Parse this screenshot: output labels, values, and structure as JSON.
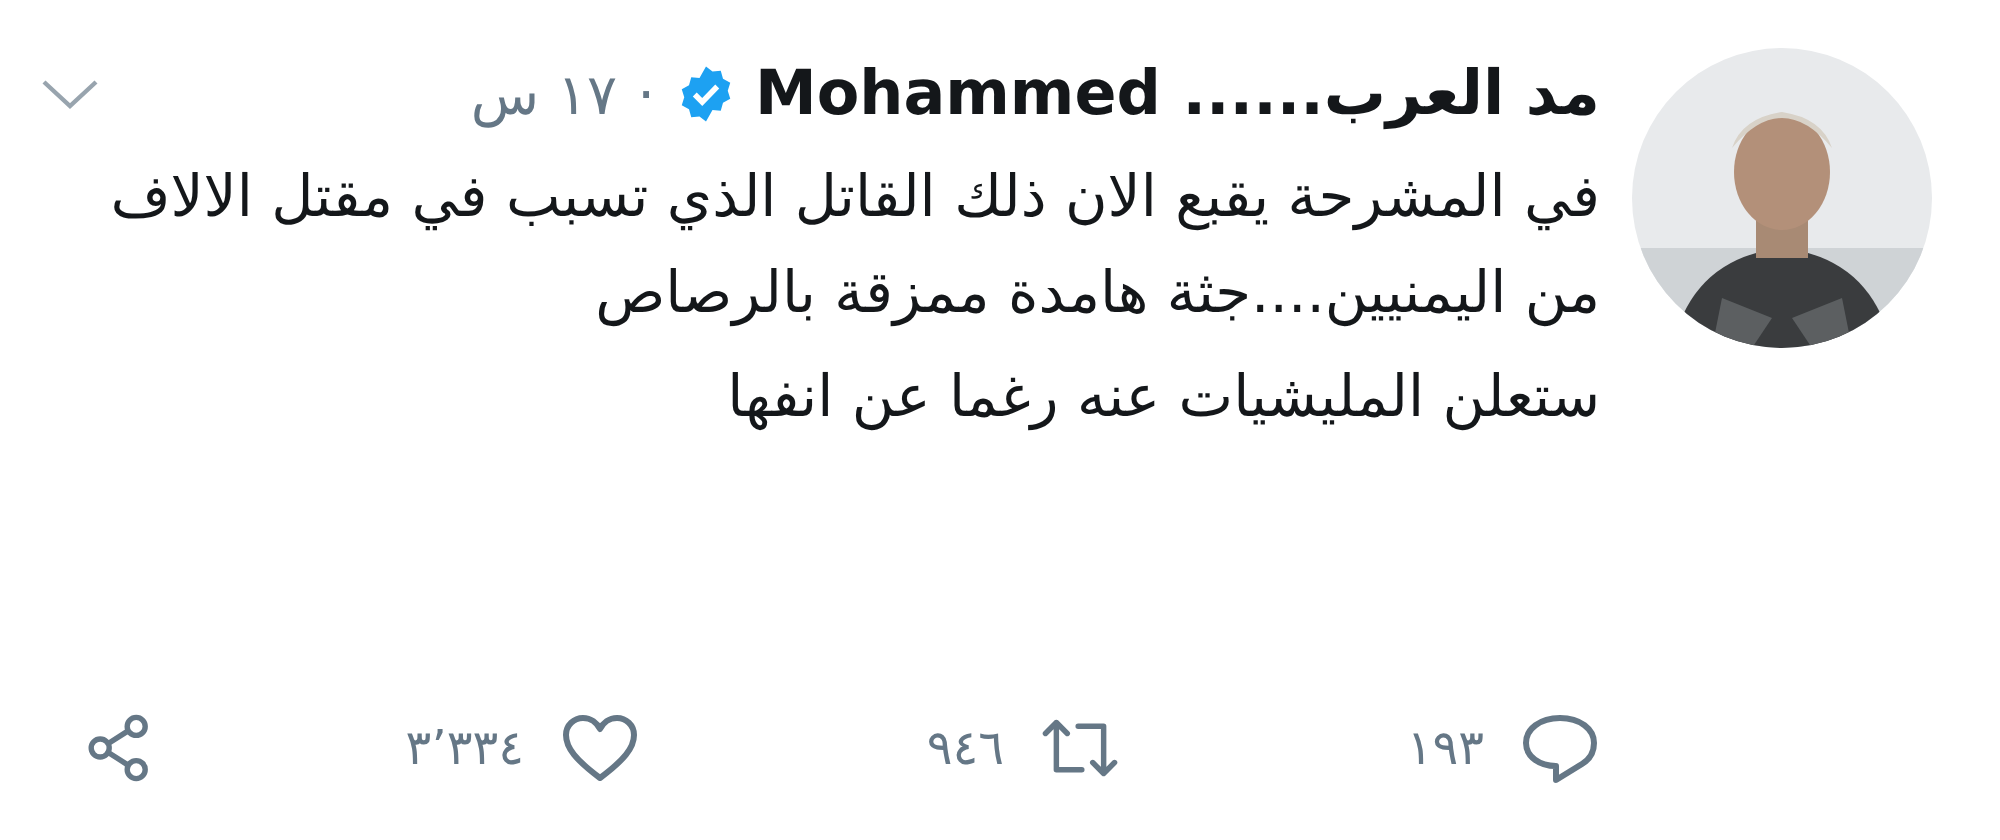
{
  "tweet": {
    "author": "مد العرب...... Mohammed",
    "verified": true,
    "time": "١٧ س",
    "separator": "·",
    "paragraphs": [
      "في المشرحة يقبع الان ذلك القاتل الذي تسبب في مقتل الالاف من اليمنيين....جثة هامدة ممزقة بالرصاص",
      "ستعلن المليشيات عنه رغما عن انفها"
    ],
    "actions": [
      {
        "kind": "reply",
        "count": "١٩٣"
      },
      {
        "kind": "retweet",
        "count": "٩٤٦"
      },
      {
        "kind": "like",
        "count": "٣٬٣٣٤"
      },
      {
        "kind": "share"
      }
    ]
  }
}
